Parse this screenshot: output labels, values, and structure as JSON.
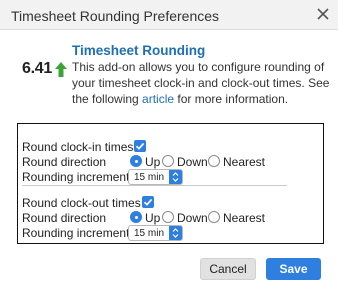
{
  "dialog": {
    "title": "Timesheet Rounding Preferences",
    "close_icon": "close-icon"
  },
  "addon": {
    "logo_text": "6.41",
    "logo_icon": "up-arrow-icon",
    "heading": "Timesheet Rounding",
    "description_before": "This add-on allows you to configure rounding of your timesheet clock-in and clock-out times. See the following ",
    "description_link": "article",
    "description_after": " for more information."
  },
  "clock_in": {
    "round_label": "Round clock-in times",
    "round_checked": true,
    "direction_label": "Round direction",
    "direction_options": [
      "Up",
      "Down",
      "Nearest"
    ],
    "direction_selected": "Up",
    "increment_label": "Rounding increment",
    "increment_value": "15 min"
  },
  "clock_out": {
    "round_label": "Round clock-out times",
    "round_checked": true,
    "direction_label": "Round direction",
    "direction_options": [
      "Up",
      "Down",
      "Nearest"
    ],
    "direction_selected": "Up",
    "increment_label": "Rounding increment",
    "increment_value": "15 min"
  },
  "buttons": {
    "cancel": "Cancel",
    "save": "Save"
  },
  "colors": {
    "accent": "#2e7fe0",
    "heading": "#1e6fb4",
    "logo_arrow": "#3aa535"
  }
}
